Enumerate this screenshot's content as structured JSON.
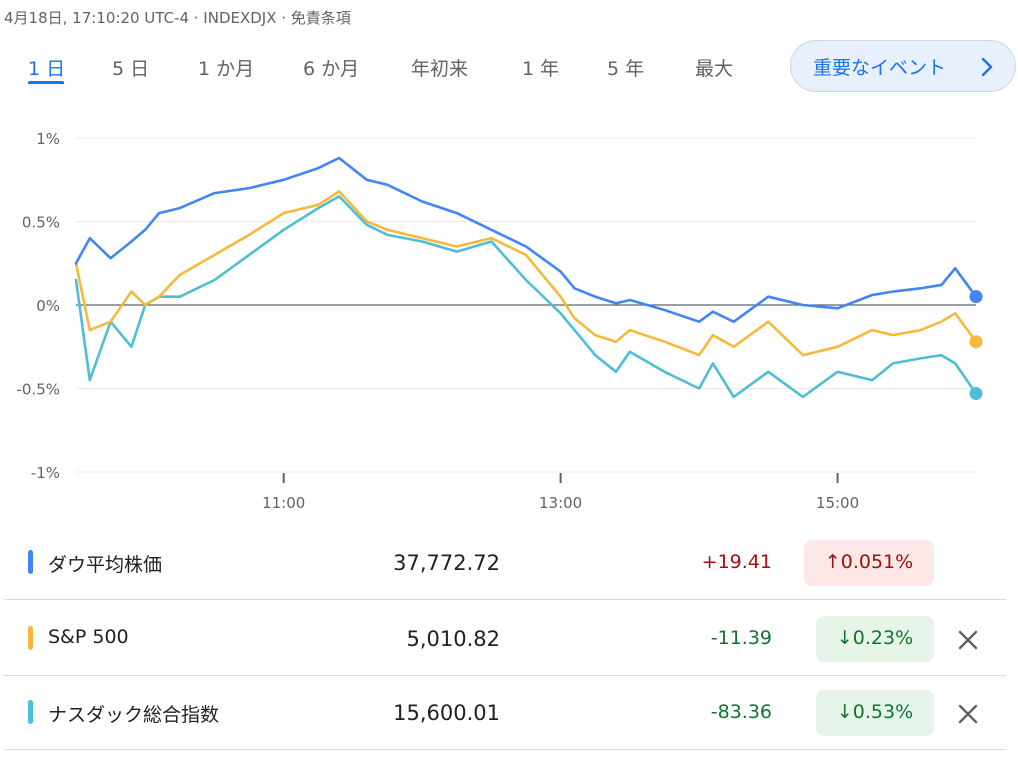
{
  "meta_text": "4月18日, 17:10:20 UTC-4 · INDEXDJX · 免責条項",
  "tabs": [
    {
      "label": "1 日",
      "active": true
    },
    {
      "label": "5 日",
      "active": false
    },
    {
      "label": "1 か月",
      "active": false
    },
    {
      "label": "6 か月",
      "active": false
    },
    {
      "label": "年初来",
      "active": false
    },
    {
      "label": "1 年",
      "active": false
    },
    {
      "label": "5 年",
      "active": false
    },
    {
      "label": "最大",
      "active": false
    }
  ],
  "event_button": {
    "label": "重要なイベント",
    "icon": "chevron-right-icon"
  },
  "colors": {
    "dow": "#4285f4",
    "sp500": "#f6b93b",
    "nasdaq": "#4ebed6",
    "zero_line": "#5f6368",
    "grid": "#e8eaed",
    "tick_text": "#5f6368"
  },
  "chart_data": {
    "type": "line",
    "y_ticks": [
      "1%",
      "0.5%",
      "0%",
      "-0.5%",
      "-1%"
    ],
    "y_tick_values": [
      1,
      0.5,
      0,
      -0.5,
      -1
    ],
    "x_ticks": [
      "11:00",
      "13:00",
      "15:00"
    ],
    "x_tick_hours": [
      11,
      13,
      15
    ],
    "x_range_hours": [
      9.5,
      16.0
    ],
    "ylim": [
      -1,
      1
    ],
    "grid": true,
    "series": [
      {
        "name": "ダウ平均株価",
        "color_key": "dow",
        "x": [
          9.5,
          9.6,
          9.75,
          9.9,
          10.0,
          10.1,
          10.25,
          10.5,
          10.75,
          11.0,
          11.25,
          11.4,
          11.6,
          11.75,
          12.0,
          12.25,
          12.5,
          12.75,
          13.0,
          13.1,
          13.25,
          13.4,
          13.5,
          13.75,
          14.0,
          14.1,
          14.25,
          14.5,
          14.75,
          15.0,
          15.25,
          15.4,
          15.6,
          15.75,
          15.85,
          16.0
        ],
        "y": [
          0.25,
          0.4,
          0.28,
          0.38,
          0.45,
          0.55,
          0.58,
          0.67,
          0.7,
          0.75,
          0.82,
          0.88,
          0.75,
          0.72,
          0.62,
          0.55,
          0.45,
          0.35,
          0.2,
          0.1,
          0.05,
          0.01,
          0.03,
          -0.03,
          -0.1,
          -0.04,
          -0.1,
          0.05,
          0.0,
          -0.02,
          0.06,
          0.08,
          0.1,
          0.12,
          0.22,
          0.05
        ]
      },
      {
        "name": "S&P 500",
        "color_key": "sp500",
        "x": [
          9.5,
          9.6,
          9.75,
          9.9,
          10.0,
          10.1,
          10.25,
          10.5,
          10.75,
          11.0,
          11.25,
          11.4,
          11.6,
          11.75,
          12.0,
          12.25,
          12.5,
          12.75,
          13.0,
          13.1,
          13.25,
          13.4,
          13.5,
          13.75,
          14.0,
          14.1,
          14.25,
          14.5,
          14.75,
          15.0,
          15.25,
          15.4,
          15.6,
          15.75,
          15.85,
          16.0
        ],
        "y": [
          0.25,
          -0.15,
          -0.1,
          0.08,
          0.0,
          0.05,
          0.18,
          0.3,
          0.42,
          0.55,
          0.6,
          0.68,
          0.5,
          0.45,
          0.4,
          0.35,
          0.4,
          0.3,
          0.05,
          -0.08,
          -0.18,
          -0.22,
          -0.15,
          -0.22,
          -0.3,
          -0.18,
          -0.25,
          -0.1,
          -0.3,
          -0.25,
          -0.15,
          -0.18,
          -0.15,
          -0.1,
          -0.05,
          -0.22
        ]
      },
      {
        "name": "ナスダック総合指数",
        "color_key": "nasdaq",
        "x": [
          9.5,
          9.6,
          9.75,
          9.9,
          10.0,
          10.1,
          10.25,
          10.5,
          10.75,
          11.0,
          11.25,
          11.4,
          11.6,
          11.75,
          12.0,
          12.25,
          12.5,
          12.75,
          13.0,
          13.1,
          13.25,
          13.4,
          13.5,
          13.75,
          14.0,
          14.1,
          14.25,
          14.5,
          14.75,
          15.0,
          15.25,
          15.4,
          15.6,
          15.75,
          15.85,
          16.0
        ],
        "y": [
          0.15,
          -0.45,
          -0.1,
          -0.25,
          0.0,
          0.05,
          0.05,
          0.15,
          0.3,
          0.45,
          0.58,
          0.65,
          0.48,
          0.42,
          0.38,
          0.32,
          0.38,
          0.15,
          -0.05,
          -0.15,
          -0.3,
          -0.4,
          -0.28,
          -0.4,
          -0.5,
          -0.35,
          -0.55,
          -0.4,
          -0.55,
          -0.4,
          -0.45,
          -0.35,
          -0.32,
          -0.3,
          -0.35,
          -0.53
        ]
      }
    ]
  },
  "indices": [
    {
      "name": "ダウ平均株価",
      "value": "37,772.72",
      "change": "+19.41",
      "direction": "up",
      "pct": "0.051%",
      "removable": false,
      "color_key": "dow"
    },
    {
      "name": "S&P 500",
      "value": "5,010.82",
      "change": "-11.39",
      "direction": "down",
      "pct": "0.23%",
      "removable": true,
      "color_key": "sp500"
    },
    {
      "name": "ナスダック総合指数",
      "value": "15,600.01",
      "change": "-83.36",
      "direction": "down",
      "pct": "0.53%",
      "removable": true,
      "color_key": "nasdaq"
    }
  ]
}
